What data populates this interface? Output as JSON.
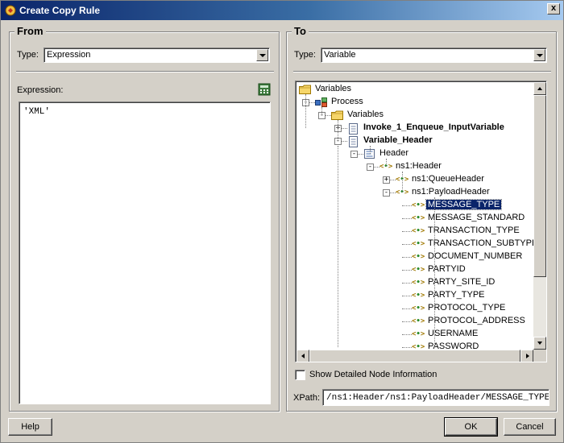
{
  "window": {
    "title": "Create Copy Rule",
    "close_label": "x"
  },
  "from": {
    "title": "From",
    "type_label": "Type:",
    "type_value": "Expression",
    "expression_label": "Expression:",
    "expression_value": "'XML'"
  },
  "to": {
    "title": "To",
    "type_label": "Type:",
    "type_value": "Variable",
    "tree": [
      {
        "label": "Variables",
        "icon": "folder-icon",
        "bold": false
      },
      {
        "label": "Process",
        "icon": "process-icon",
        "bold": false,
        "expander": "-"
      },
      {
        "label": "Variables",
        "icon": "folder-icon",
        "bold": false,
        "expander": "-"
      },
      {
        "label": "Invoke_1_Enqueue_InputVariable",
        "icon": "variable-icon",
        "bold": true,
        "expander": "+"
      },
      {
        "label": "Variable_Header",
        "icon": "variable-icon",
        "bold": true,
        "expander": "-"
      },
      {
        "label": "Header",
        "icon": "message-part-icon",
        "bold": false,
        "expander": "-"
      },
      {
        "label": "ns1:Header",
        "icon": "element-icon",
        "bold": false,
        "expander": "-"
      },
      {
        "label": "ns1:QueueHeader",
        "icon": "element-icon",
        "bold": false,
        "expander": "+"
      },
      {
        "label": "ns1:PayloadHeader",
        "icon": "element-icon",
        "bold": false,
        "expander": "-"
      },
      {
        "label": "MESSAGE_TYPE",
        "icon": "element-icon",
        "bold": false,
        "selected": true
      },
      {
        "label": "MESSAGE_STANDARD",
        "icon": "element-icon",
        "bold": false
      },
      {
        "label": "TRANSACTION_TYPE",
        "icon": "element-icon",
        "bold": false
      },
      {
        "label": "TRANSACTION_SUBTYPE",
        "icon": "element-icon",
        "bold": false
      },
      {
        "label": "DOCUMENT_NUMBER",
        "icon": "element-icon",
        "bold": false
      },
      {
        "label": "PARTYID",
        "icon": "element-icon",
        "bold": false
      },
      {
        "label": "PARTY_SITE_ID",
        "icon": "element-icon",
        "bold": false
      },
      {
        "label": "PARTY_TYPE",
        "icon": "element-icon",
        "bold": false
      },
      {
        "label": "PROTOCOL_TYPE",
        "icon": "element-icon",
        "bold": false
      },
      {
        "label": "PROTOCOL_ADDRESS",
        "icon": "element-icon",
        "bold": false
      },
      {
        "label": "USERNAME",
        "icon": "element-icon",
        "bold": false
      },
      {
        "label": "PASSWORD",
        "icon": "element-icon",
        "bold": false
      }
    ],
    "show_detailed_label": "Show Detailed Node Information",
    "show_detailed_checked": false,
    "xpath_label": "XPath:",
    "xpath_value": "/ns1:Header/ns1:PayloadHeader/MESSAGE_TYPE"
  },
  "buttons": {
    "help": "Help",
    "ok": "OK",
    "cancel": "Cancel"
  }
}
